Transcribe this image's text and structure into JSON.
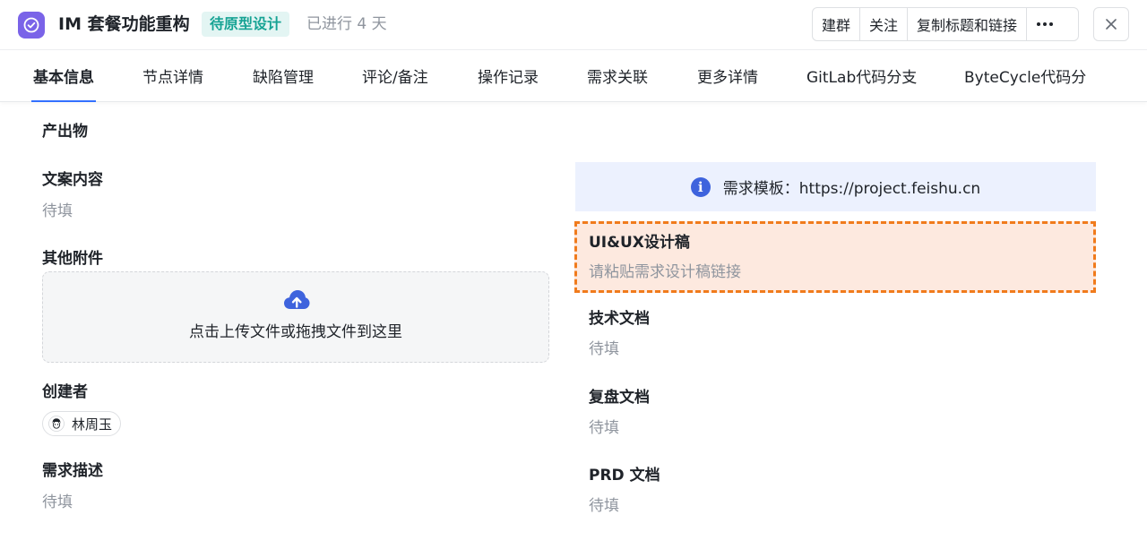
{
  "header": {
    "title": "IM 套餐功能重构",
    "status": "待原型设计",
    "elapsed": "已进行 4 天",
    "actions": [
      "建群",
      "关注",
      "复制标题和链接"
    ],
    "more_icon": "more-horizontal-icon",
    "close_icon": "close-icon",
    "app_icon": "check-circle-icon",
    "colors": {
      "app_icon_bg": "#7a63e8",
      "status_bg": "#e3f5f3",
      "status_text": "#16a394"
    }
  },
  "tabs": [
    {
      "label": "基本信息",
      "active": true
    },
    {
      "label": "节点详情"
    },
    {
      "label": "缺陷管理"
    },
    {
      "label": "评论/备注"
    },
    {
      "label": "操作记录"
    },
    {
      "label": "需求关联"
    },
    {
      "label": "更多详情"
    },
    {
      "label": "GitLab代码分支"
    },
    {
      "label": "ByteCycle代码分"
    }
  ],
  "left": {
    "section_title": "产出物",
    "copy_content": {
      "label": "文案内容",
      "value": "待填"
    },
    "attachments": {
      "label": "其他附件",
      "upload_text": "点击上传文件或拖拽文件到这里",
      "icon": "cloud-upload-icon"
    },
    "creator": {
      "label": "创建者",
      "name": "林周玉"
    },
    "description": {
      "label": "需求描述",
      "value": "待填"
    }
  },
  "right": {
    "banner": {
      "text": "需求模板：https://project.feishu.cn",
      "icon": "info-icon"
    },
    "design": {
      "label": "UI&UX设计稿",
      "placeholder": "请粘贴需求设计稿链接"
    },
    "tech_doc": {
      "label": "技术文档",
      "value": "待填"
    },
    "review_doc": {
      "label": "复盘文档",
      "value": "待填"
    },
    "prd_doc": {
      "label": "PRD 文档",
      "value": "待填"
    },
    "colors": {
      "banner_bg": "#ecf1fe",
      "highlight_border": "#f07b1c",
      "highlight_bg": "#fde9df"
    }
  }
}
